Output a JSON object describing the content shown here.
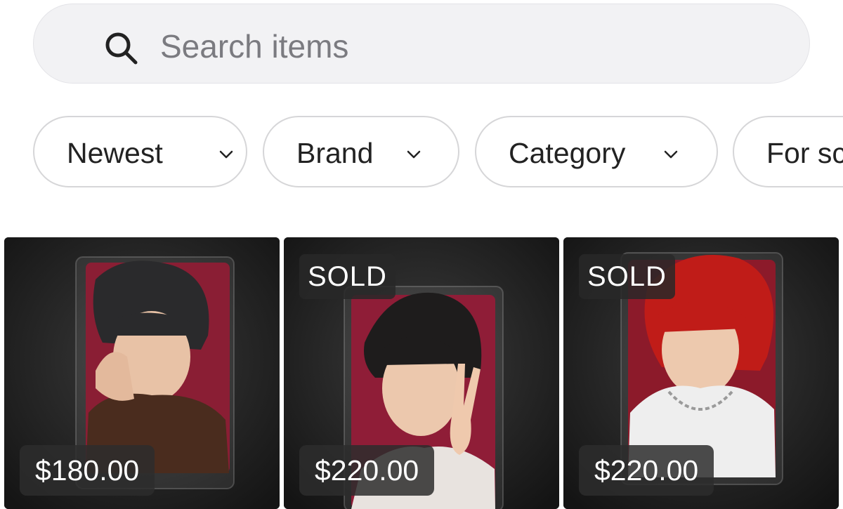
{
  "search": {
    "placeholder": "Search items"
  },
  "filters": [
    {
      "label": "Newest"
    },
    {
      "label": "Brand"
    },
    {
      "label": "Category"
    },
    {
      "label": "For sc"
    }
  ],
  "items": [
    {
      "price": "$180.00",
      "sold_label": "",
      "card_color": "#8a1e34",
      "hair_color": "#2a2a2c",
      "shirt_color": "#4a2c1e"
    },
    {
      "price": "$220.00",
      "sold_label": "SOLD",
      "card_color": "#8f1d37",
      "hair_color": "#1e1c1c",
      "shirt_color": "#e8e3df"
    },
    {
      "price": "$220.00",
      "sold_label": "SOLD",
      "card_color": "#8c1a2a",
      "hair_color": "#c01c18",
      "shirt_color": "#eeeeee"
    }
  ]
}
